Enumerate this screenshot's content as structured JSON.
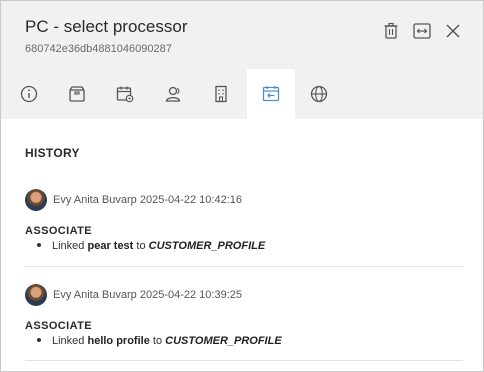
{
  "header": {
    "title": "PC - select processor",
    "subtitle": "680742e36db4881046090287"
  },
  "header_actions": [
    {
      "name": "delete-button",
      "icon": "trash-icon"
    },
    {
      "name": "expand-button",
      "icon": "expand-horizontal-icon"
    },
    {
      "name": "close-button",
      "icon": "close-icon"
    }
  ],
  "tabs": [
    {
      "name": "tab-info",
      "icon": "info-icon",
      "active": false
    },
    {
      "name": "tab-package",
      "icon": "package-icon",
      "active": false
    },
    {
      "name": "tab-calendar-settings",
      "icon": "calendar-gear-icon",
      "active": false
    },
    {
      "name": "tab-users",
      "icon": "users-icon",
      "active": false
    },
    {
      "name": "tab-building",
      "icon": "building-icon",
      "active": false
    },
    {
      "name": "tab-history",
      "icon": "calendar-back-icon",
      "active": true
    },
    {
      "name": "tab-globe",
      "icon": "globe-icon",
      "active": false
    }
  ],
  "history": {
    "title": "HISTORY",
    "entries": [
      {
        "user": "Evy Anita Buvarp",
        "timestamp": "2025-04-22 10:42:16",
        "action": "ASSOCIATE",
        "linked_prefix": "Linked",
        "linked_item": "pear test",
        "linked_connector": "to",
        "linked_target": "CUSTOMER_PROFILE"
      },
      {
        "user": "Evy Anita Buvarp",
        "timestamp": "2025-04-22 10:39:25",
        "action": "ASSOCIATE",
        "linked_prefix": "Linked",
        "linked_item": "hello profile",
        "linked_connector": "to",
        "linked_target": "CUSTOMER_PROFILE"
      }
    ]
  },
  "colors": {
    "header_bg": "#f1f1f1",
    "active_tab_bg": "#ffffff",
    "active_tab_icon": "#4a90c8",
    "icon": "#555555"
  }
}
